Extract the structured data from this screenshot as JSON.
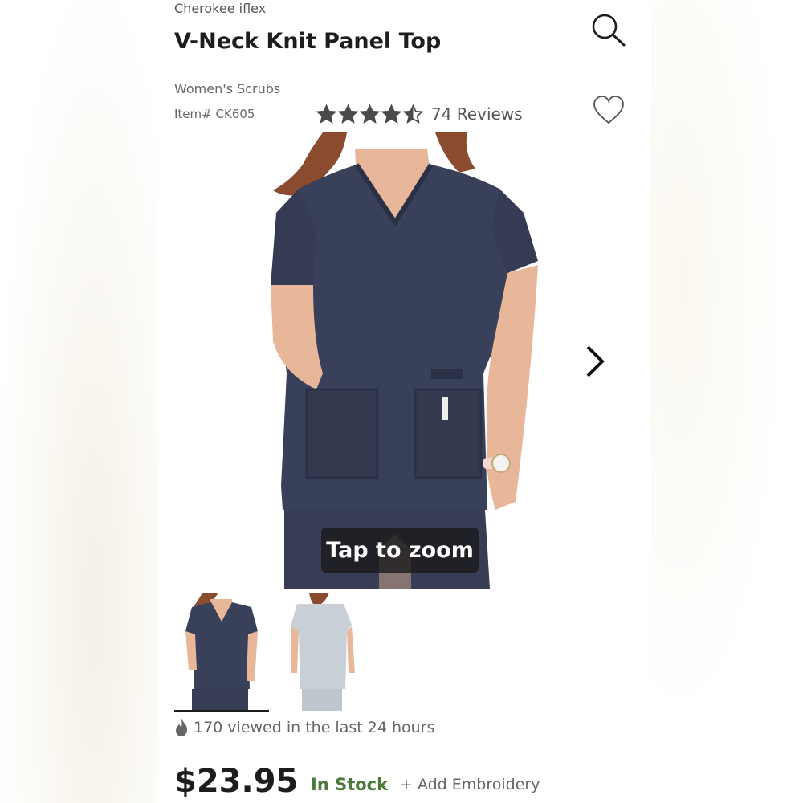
{
  "brand": {
    "label": "Cherokee iflex"
  },
  "product": {
    "title": "V-Neck Knit Panel Top",
    "category": "Women's Scrubs",
    "item_number": "Item# CK605"
  },
  "rating": {
    "stars": 4.5,
    "max_stars": 5,
    "reviews_label": "74 Reviews",
    "star_color": "#4a4a4a"
  },
  "gallery": {
    "zoom_label": "Tap to zoom",
    "selected_index": 0,
    "thumbnails": [
      {
        "name": "navy-front-thumbnail",
        "color": "#39415a"
      },
      {
        "name": "gray-back-thumbnail",
        "color": "#c9cfd6"
      }
    ]
  },
  "activity": {
    "viewed_label": "170 viewed in the last 24 hours"
  },
  "purchase": {
    "price": "$23.95",
    "stock_label": "In Stock",
    "embroidery_label": "+ Add Embroidery",
    "stock_color": "#4b7a3a"
  },
  "icons": {
    "search": "search-icon",
    "favorite": "heart-icon",
    "next": "chevron-right-icon",
    "trending": "flame-icon"
  },
  "colors": {
    "scrub_navy": "#39415a",
    "text_primary": "#1d1d1d",
    "text_secondary": "#666666"
  }
}
